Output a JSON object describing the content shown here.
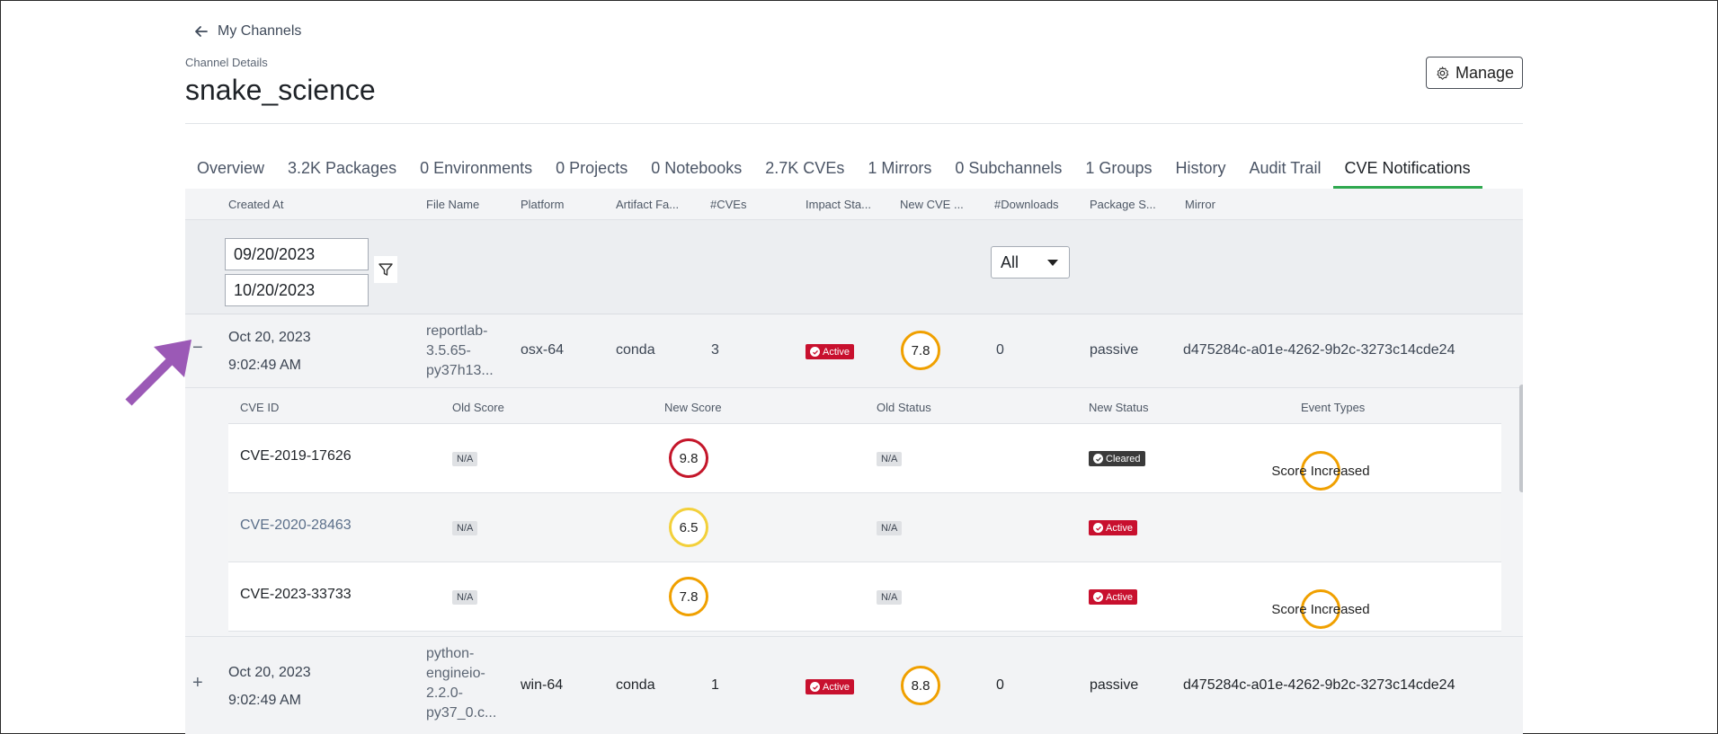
{
  "nav": {
    "back_label": "My Channels"
  },
  "header": {
    "subtitle": "Channel Details",
    "title": "snake_science",
    "manage_label": "Manage"
  },
  "tabs": [
    {
      "label": "Overview"
    },
    {
      "label": "3.2K Packages"
    },
    {
      "label": "0 Environments"
    },
    {
      "label": "0 Projects"
    },
    {
      "label": "0 Notebooks"
    },
    {
      "label": "2.7K CVEs"
    },
    {
      "label": "1 Mirrors"
    },
    {
      "label": "0 Subchannels"
    },
    {
      "label": "1 Groups"
    },
    {
      "label": "History"
    },
    {
      "label": "Audit Trail"
    },
    {
      "label": "CVE Notifications",
      "active": true
    }
  ],
  "table": {
    "columns": [
      "Created At",
      "File Name",
      "Platform",
      "Artifact Fa...",
      "#CVEs",
      "Impact Sta...",
      "New CVE ...",
      "#Downloads",
      "Package S...",
      "Mirror"
    ],
    "filters": {
      "date_from": "09/20/2023",
      "date_to": "10/20/2023",
      "downloads_select": "All"
    },
    "rows": [
      {
        "toggle": "−",
        "date": "Oct 20, 2023",
        "time": "9:02:49 AM",
        "file_name": [
          "reportlab-",
          "3.5.65-",
          "py37h13..."
        ],
        "platform": "osx-64",
        "artifact_family": "conda",
        "cves": "3",
        "impact_status": "Active",
        "new_cve_score": "7.8",
        "downloads": "0",
        "package_status": "passive",
        "mirror": "d475284c-a01e-4262-9b2c-3273c14cde24"
      },
      {
        "toggle": "+",
        "date": "Oct 20, 2023",
        "time": "9:02:49 AM",
        "file_name": [
          "python-",
          "engineio-",
          "2.2.0-",
          "py37_0.c..."
        ],
        "platform": "win-64",
        "artifact_family": "conda",
        "cves": "1",
        "impact_status": "Active",
        "new_cve_score": "8.8",
        "downloads": "0",
        "package_status": "passive",
        "mirror": "d475284c-a01e-4262-9b2c-3273c14cde24"
      }
    ]
  },
  "subtable": {
    "columns": [
      "CVE ID",
      "Old Score",
      "New Score",
      "Old Status",
      "New Status",
      "Event Types"
    ],
    "rows": [
      {
        "cve_id": "CVE-2019-17626",
        "old_score": "N/A",
        "new_score": "9.8",
        "old_status": "N/A",
        "new_status": "Cleared",
        "event_type": "Score Increased"
      },
      {
        "cve_id": "CVE-2020-28463",
        "old_score": "N/A",
        "new_score": "6.5",
        "old_status": "N/A",
        "new_status": "Active",
        "event_type": ""
      },
      {
        "cve_id": "CVE-2023-33733",
        "old_score": "N/A",
        "new_score": "7.8",
        "old_status": "N/A",
        "new_status": "Active",
        "event_type": "Score Increased"
      }
    ]
  },
  "colors": {
    "active_tab_underline": "#2fa84f",
    "active_badge": "#c8102e",
    "cleared_badge": "#3a3a3a",
    "score_high": "#c4162a",
    "score_medium": "#f0a000",
    "score_low": "#f3d03a",
    "annotation_arrow": "#9b59b6"
  }
}
